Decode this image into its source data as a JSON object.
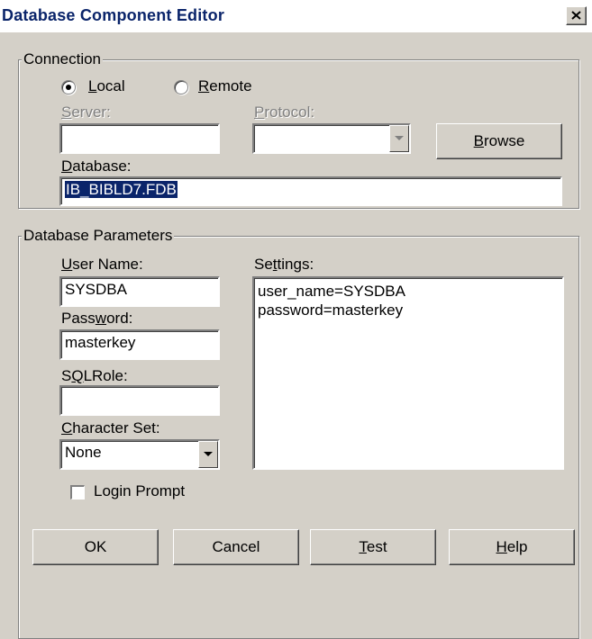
{
  "window": {
    "title": "Database Component Editor",
    "close_glyph": "×"
  },
  "connection": {
    "legend": "Connection",
    "mode": "Local",
    "local_label_u": "L",
    "local_label_rest": "ocal",
    "remote_label_u": "R",
    "remote_label_rest": "emote",
    "server_label_u": "S",
    "server_label_rest": "erver:",
    "server_value": "",
    "protocol_label_u": "P",
    "protocol_label_rest": "rotocol:",
    "protocol_value": "",
    "browse_label_u": "B",
    "browse_label_rest": "rowse",
    "database_label_u": "D",
    "database_label_rest": "atabase:",
    "database_value": "IB_BIBLD7.FDB"
  },
  "params": {
    "legend": "Database Parameters",
    "username_label_u": "U",
    "username_label_rest": "ser Name:",
    "username_value": "SYSDBA",
    "password_label_pre": "Pass",
    "password_label_u": "w",
    "password_label_rest": "ord:",
    "password_value": "masterkey",
    "sqlrole_label_pre": "S",
    "sqlrole_label_u": "Q",
    "sqlrole_label_rest": "LRole:",
    "sqlrole_value": "",
    "charset_label_u": "C",
    "charset_label_rest": "haracter Set:",
    "charset_value": "None",
    "settings_label_pre": "Se",
    "settings_label_u": "t",
    "settings_label_rest": "tings:",
    "settings_lines": [
      "user_name=SYSDBA",
      "password=masterkey"
    ],
    "login_prompt_label": "Login Prompt",
    "login_prompt_checked": false
  },
  "buttons": {
    "ok": "OK",
    "cancel": "Cancel",
    "test_u": "T",
    "test_rest": "est",
    "help_u": "H",
    "help_rest": "elp"
  },
  "colors": {
    "titlebar_text": "#0a246a",
    "selection": "#0a246a",
    "face": "#d4d0c8"
  }
}
